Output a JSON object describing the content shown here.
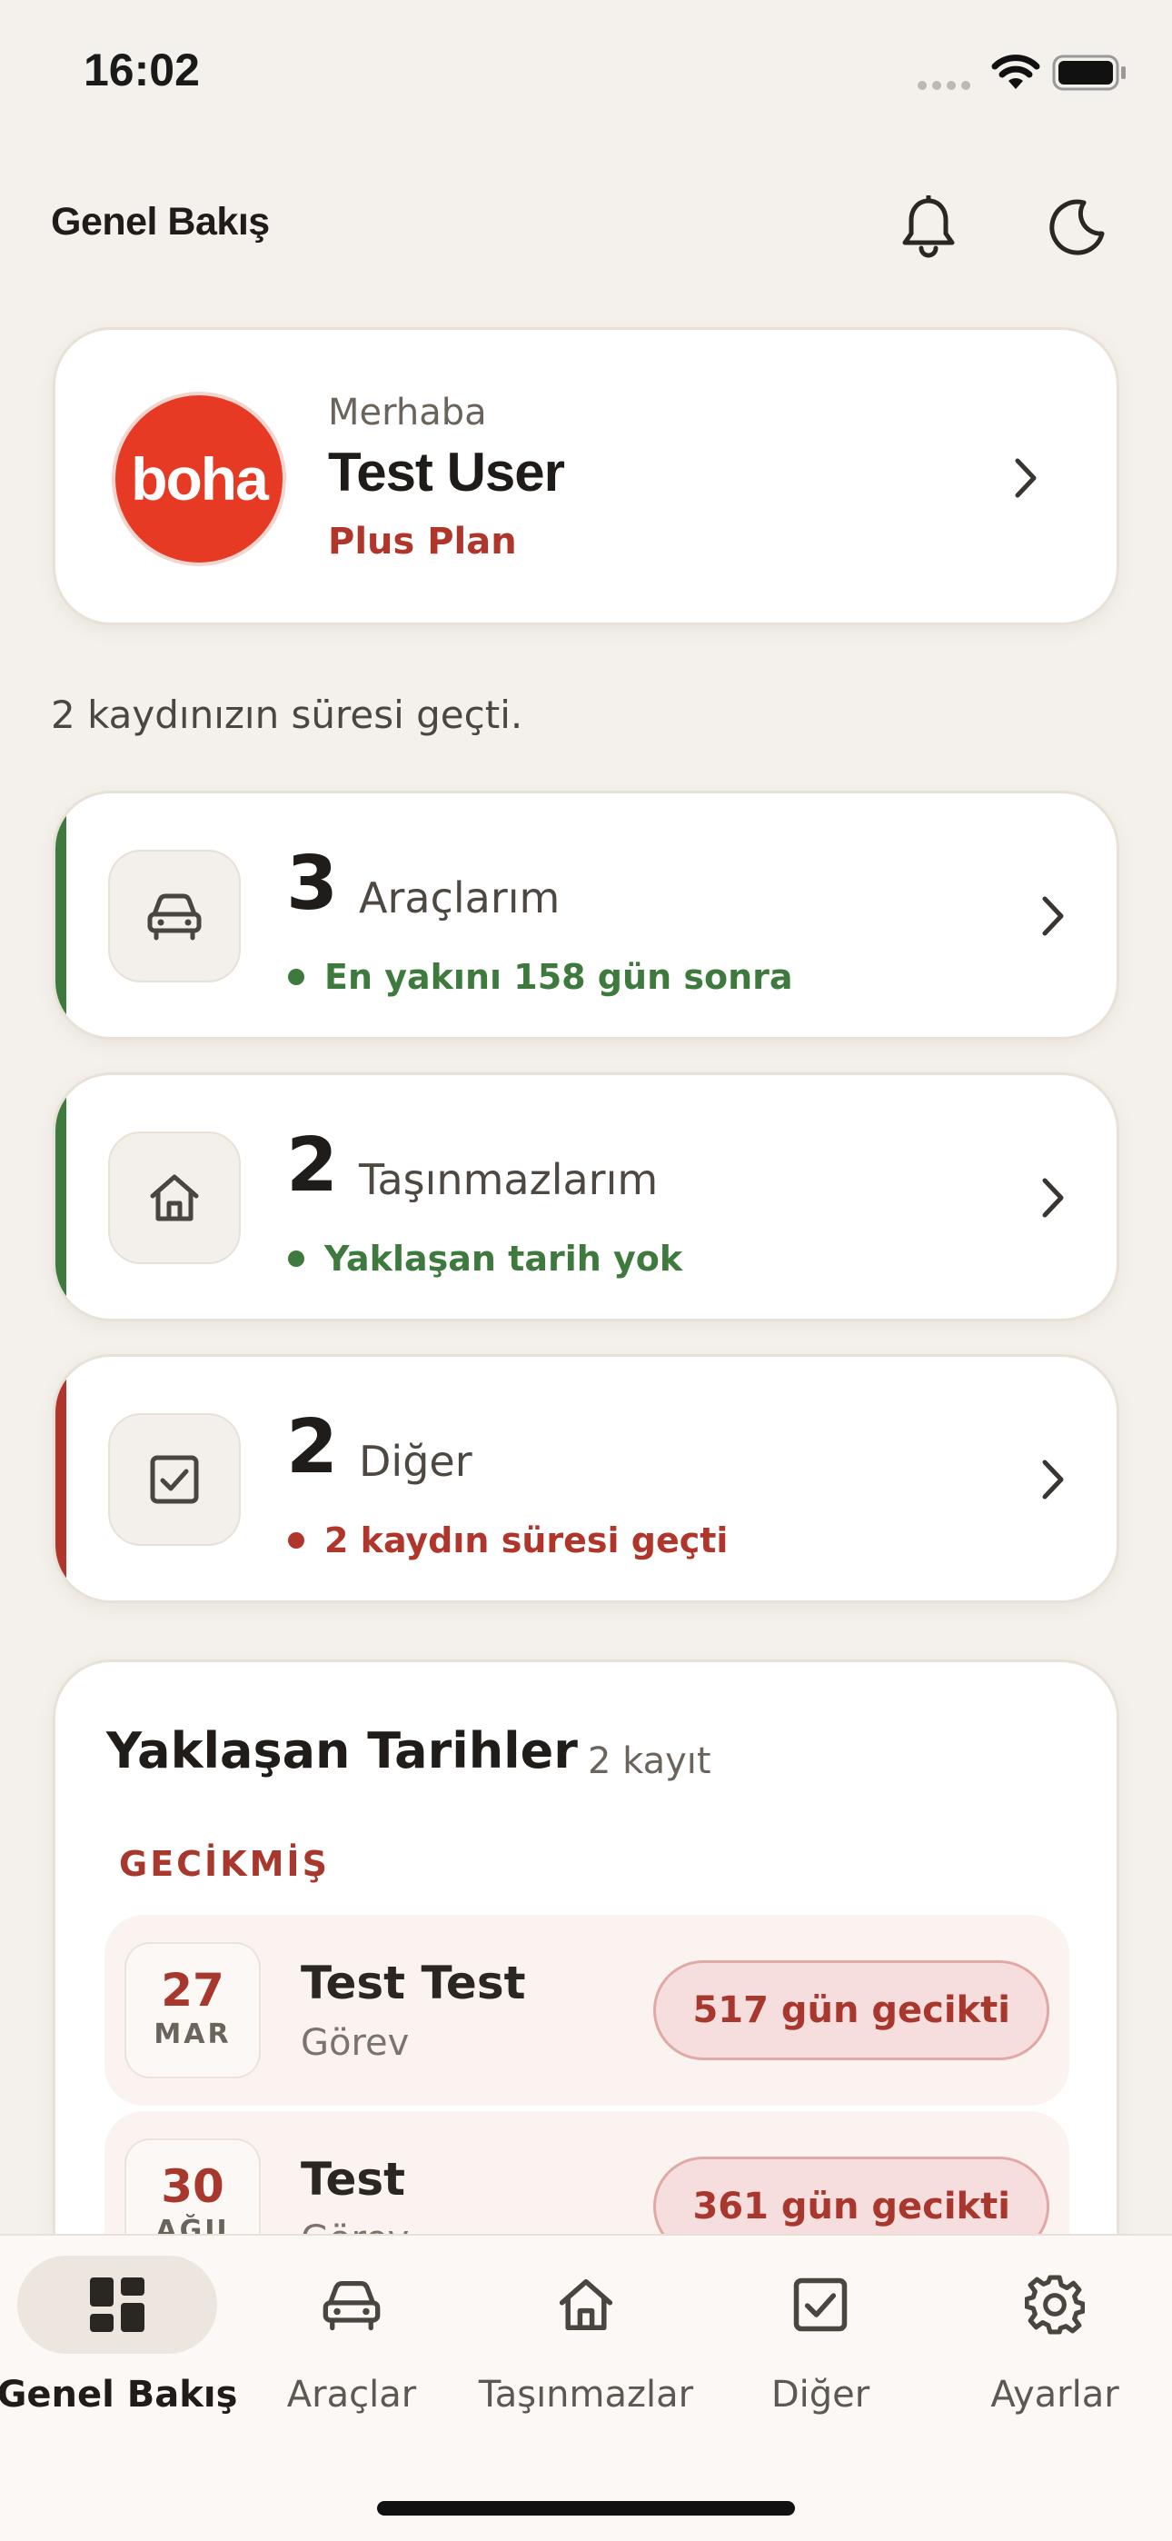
{
  "status_bar": {
    "time": "16:02"
  },
  "header": {
    "title": "Genel Bakış",
    "bell_icon": "bell-icon",
    "theme_icon": "moon-icon"
  },
  "profile": {
    "greeting": "Merhaba",
    "name": "Test User",
    "plan": "Plus Plan",
    "logo_text": "boha"
  },
  "expired_note": "2 kaydınızın süresi geçti.",
  "categories": [
    {
      "count": "3",
      "label": "Araçlarım",
      "status": "En yakını 158 gün sonra",
      "status_color": "#3e7a3e",
      "stripe_color": "#3e7a3e",
      "icon": "car-icon"
    },
    {
      "count": "2",
      "label": "Taşınmazlarım",
      "status": "Yaklaşan tarih yok",
      "status_color": "#3e7a3e",
      "stripe_color": "#3e7a3e",
      "icon": "home-icon"
    },
    {
      "count": "2",
      "label": "Diğer",
      "status": "2 kaydın süresi geçti",
      "status_color": "#b0352b",
      "stripe_color": "#b0352b",
      "icon": "checkbox-icon"
    }
  ],
  "upcoming": {
    "title": "Yaklaşan Tarihler",
    "count": "2 kayıt",
    "overdue_heading": "GECİKMİŞ",
    "items": [
      {
        "day": "27",
        "month": "MAR",
        "title": "Test Test",
        "type": "Görev",
        "late": "517 gün gecikti"
      },
      {
        "day": "30",
        "month": "AĞU",
        "title": "Test",
        "type": "Görev",
        "late": "361 gün gecikti"
      }
    ]
  },
  "nav": [
    {
      "label": "Genel Bakış",
      "icon": "dashboard-icon",
      "active": true
    },
    {
      "label": "Araçlar",
      "icon": "car-icon"
    },
    {
      "label": "Taşınmazlar",
      "icon": "home-icon"
    },
    {
      "label": "Diğer",
      "icon": "checkbox-icon"
    },
    {
      "label": "Ayarlar",
      "icon": "gear-icon"
    }
  ]
}
